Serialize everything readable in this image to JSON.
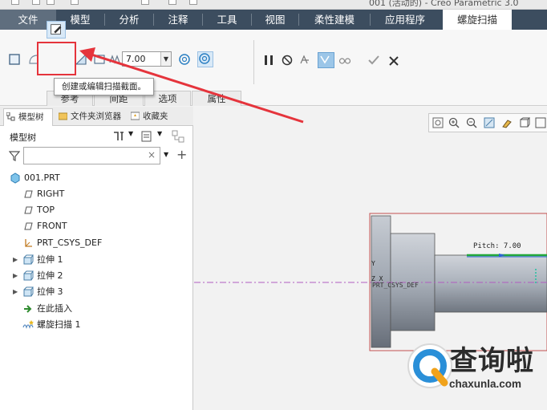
{
  "title": "001 (活动的) - Creo Parametric 3.0",
  "tabs": [
    {
      "label": "文件",
      "kind": "file"
    },
    {
      "label": "模型"
    },
    {
      "label": "分析"
    },
    {
      "label": "注释"
    },
    {
      "label": "工具"
    },
    {
      "label": "视图"
    },
    {
      "label": "柔性建模"
    },
    {
      "label": "应用程序"
    },
    {
      "label": "螺旋扫描",
      "kind": "active"
    }
  ],
  "ribbon": {
    "pitch_value": "7.00",
    "tooltip": "创建或编辑扫描截面。",
    "subtabs": [
      "参考",
      "间距",
      "选项",
      "属性"
    ],
    "icons": [
      "solid-icon",
      "surface-icon",
      "sketch-edit-icon",
      "remove-material-icon",
      "thicken-icon",
      "pitch-icon",
      "left-handed-icon",
      "right-handed-icon",
      "pause-icon",
      "no-preview-icon",
      "preview-icon",
      "verify-icon",
      "glasses-icon",
      "confirm-icon",
      "cancel-icon"
    ]
  },
  "panel": {
    "tabs": [
      "模型树",
      "文件夹浏览器",
      "收藏夹"
    ],
    "tree_header": "模型树",
    "filter_value": "",
    "nodes": [
      {
        "label": "001.PRT",
        "icon": "part-icon",
        "indent": 0,
        "expandable": false
      },
      {
        "label": "RIGHT",
        "icon": "datum-plane-icon",
        "indent": 1,
        "expandable": false
      },
      {
        "label": "TOP",
        "icon": "datum-plane-icon",
        "indent": 1,
        "expandable": false
      },
      {
        "label": "FRONT",
        "icon": "datum-plane-icon",
        "indent": 1,
        "expandable": false
      },
      {
        "label": "PRT_CSYS_DEF",
        "icon": "csys-icon",
        "indent": 1,
        "expandable": false
      },
      {
        "label": "拉伸 1",
        "icon": "extrude-icon",
        "indent": 1,
        "expandable": true
      },
      {
        "label": "拉伸 2",
        "icon": "extrude-icon",
        "indent": 1,
        "expandable": true
      },
      {
        "label": "拉伸 3",
        "icon": "extrude-icon",
        "indent": 1,
        "expandable": true
      },
      {
        "label": "在此插入",
        "icon": "insert-here-icon",
        "indent": 1,
        "expandable": false
      },
      {
        "label": "螺旋扫描 1",
        "icon": "helical-sweep-icon",
        "indent": 1,
        "expandable": false
      }
    ]
  },
  "viewport": {
    "pitch_annotation": "Pitch: 7.00",
    "csys_label": "PRT_CSYS_DEF",
    "axis_y": "Y",
    "axis_zx": "Z X"
  },
  "watermark": {
    "text": "查询啦",
    "url": "chaxunla.com"
  },
  "colors": {
    "tab_bar": "#3c4d5f",
    "highlight": "#e5343c",
    "model_gray": "#9aa1ab",
    "pitch_green": "#22a83a",
    "centerline": "#b05cc0"
  }
}
